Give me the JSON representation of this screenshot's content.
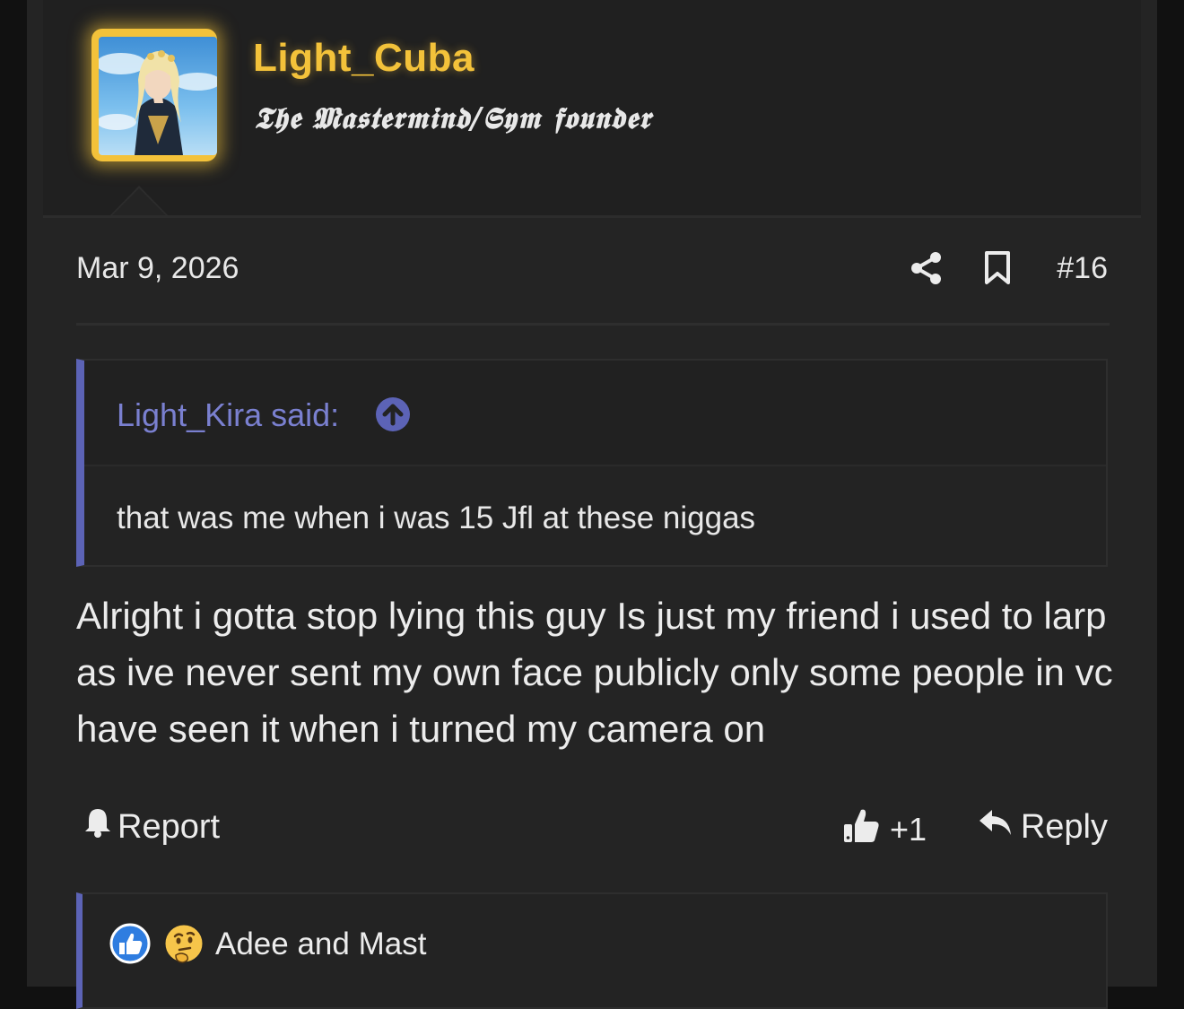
{
  "post": {
    "username": "Light_Cuba",
    "user_title": "𝕿𝖍𝖊 𝕸𝖆𝖘𝖙𝖊𝖗𝖒𝖎𝖓𝖉/𝕾𝖞𝖒 𝖋𝖔𝖚𝖓𝖉𝖊𝖗",
    "date": "Mar 9, 2026",
    "post_number": "#16",
    "accent_color": "#f3c23a",
    "quote": {
      "author": "Light_Kira said:",
      "text": "that was me when i was 15 Jfl at these niggas"
    },
    "message": "Alright i gotta stop lying this guy Is just my friend i used to larp as ive never sent my own face publicly only some people in vc have seen it when i turned my camera on"
  },
  "actions": {
    "report_label": "Report",
    "like_count": "+1",
    "reply_label": "Reply"
  },
  "reactions": {
    "icons": [
      "like-reaction-icon",
      "thinking-reaction-icon"
    ],
    "names": "Adee and Mast"
  },
  "colors": {
    "background": "#242424",
    "quote_bar": "#5c63b6",
    "quote_author": "#7a80d0",
    "text": "#ececec"
  }
}
